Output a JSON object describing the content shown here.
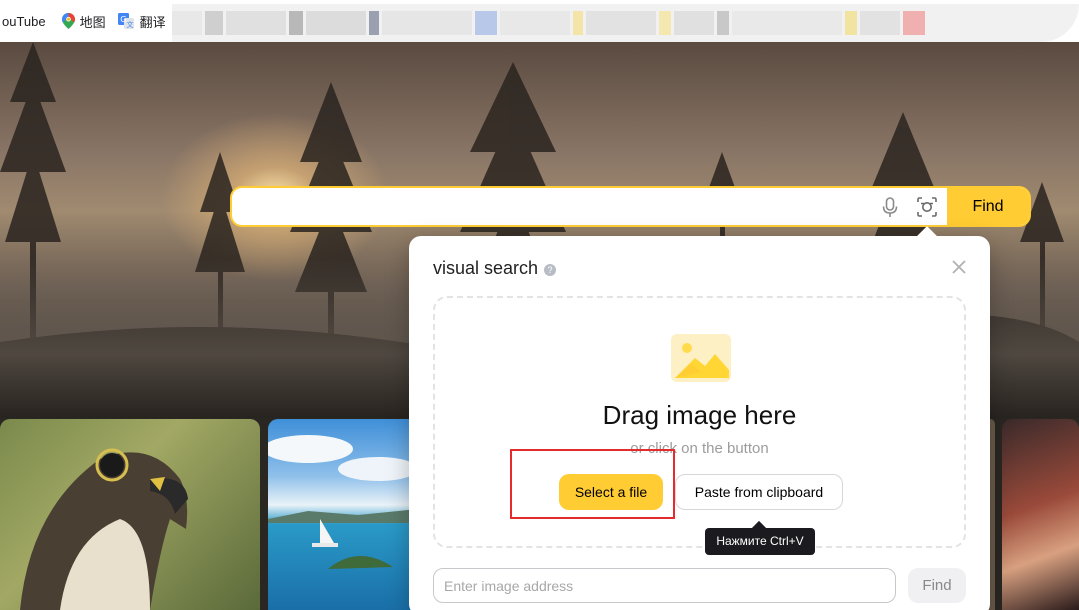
{
  "bookmarks": {
    "youtube_label": "ouTube",
    "maps_label": "地图",
    "translate_label": "翻译"
  },
  "search": {
    "find_label": "Find",
    "input_value": ""
  },
  "visual_search": {
    "title": "visual search",
    "help_glyph": "?",
    "drag_text": "Drag image here",
    "or_text": "or click on the button",
    "select_file_label": "Select a file",
    "paste_label": "Paste from clipboard",
    "tooltip": "Нажмите Ctrl+V",
    "url_placeholder": "Enter image address",
    "url_find_label": "Find"
  },
  "icons": {
    "maps": "map-pin-icon",
    "translate": "google-translate-icon",
    "mic": "microphone-icon",
    "lens": "camera-search-icon",
    "close": "close-icon",
    "image": "image-placeholder-icon"
  },
  "colors": {
    "accent_yellow": "#ffcc33",
    "highlight_red": "#e52b2b",
    "tooltip_bg": "#1b1b1f"
  }
}
